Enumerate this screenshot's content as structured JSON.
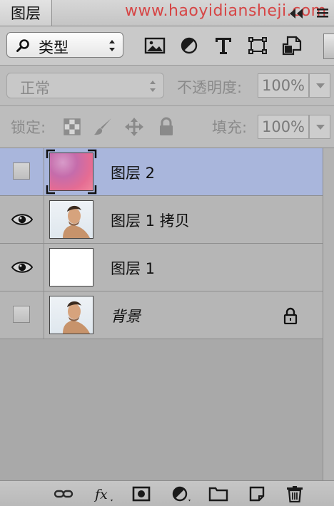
{
  "panel": {
    "tab_title": "图层",
    "watermark": "www.haoyidiansheji.com"
  },
  "filter": {
    "kind_label": "类型",
    "icons": [
      "image-filter-icon",
      "adjustment-filter-icon",
      "type-filter-icon",
      "shape-filter-icon",
      "smart-object-filter-icon"
    ]
  },
  "blend": {
    "mode": "正常",
    "opacity_label": "不透明度:",
    "opacity_value": "100%"
  },
  "lock": {
    "label": "锁定:",
    "fill_label": "填充:",
    "fill_value": "100%"
  },
  "layers": [
    {
      "name": "图层 2",
      "visible": false,
      "selected": true,
      "thumb": "pink-gradient"
    },
    {
      "name": "图层 1 拷贝",
      "visible": true,
      "selected": false,
      "thumb": "portrait"
    },
    {
      "name": "图层 1",
      "visible": true,
      "selected": false,
      "thumb": "white"
    },
    {
      "name": "背景",
      "visible": false,
      "selected": false,
      "thumb": "portrait",
      "locked": true,
      "italic": true
    }
  ],
  "colors": {
    "selected_row": "#a9b6dc",
    "watermark": "#d64545"
  },
  "bottom_toolbar": [
    "link-layers-icon",
    "fx-icon",
    "add-mask-icon",
    "adjustment-layer-icon",
    "new-group-icon",
    "new-layer-icon",
    "delete-layer-icon"
  ]
}
